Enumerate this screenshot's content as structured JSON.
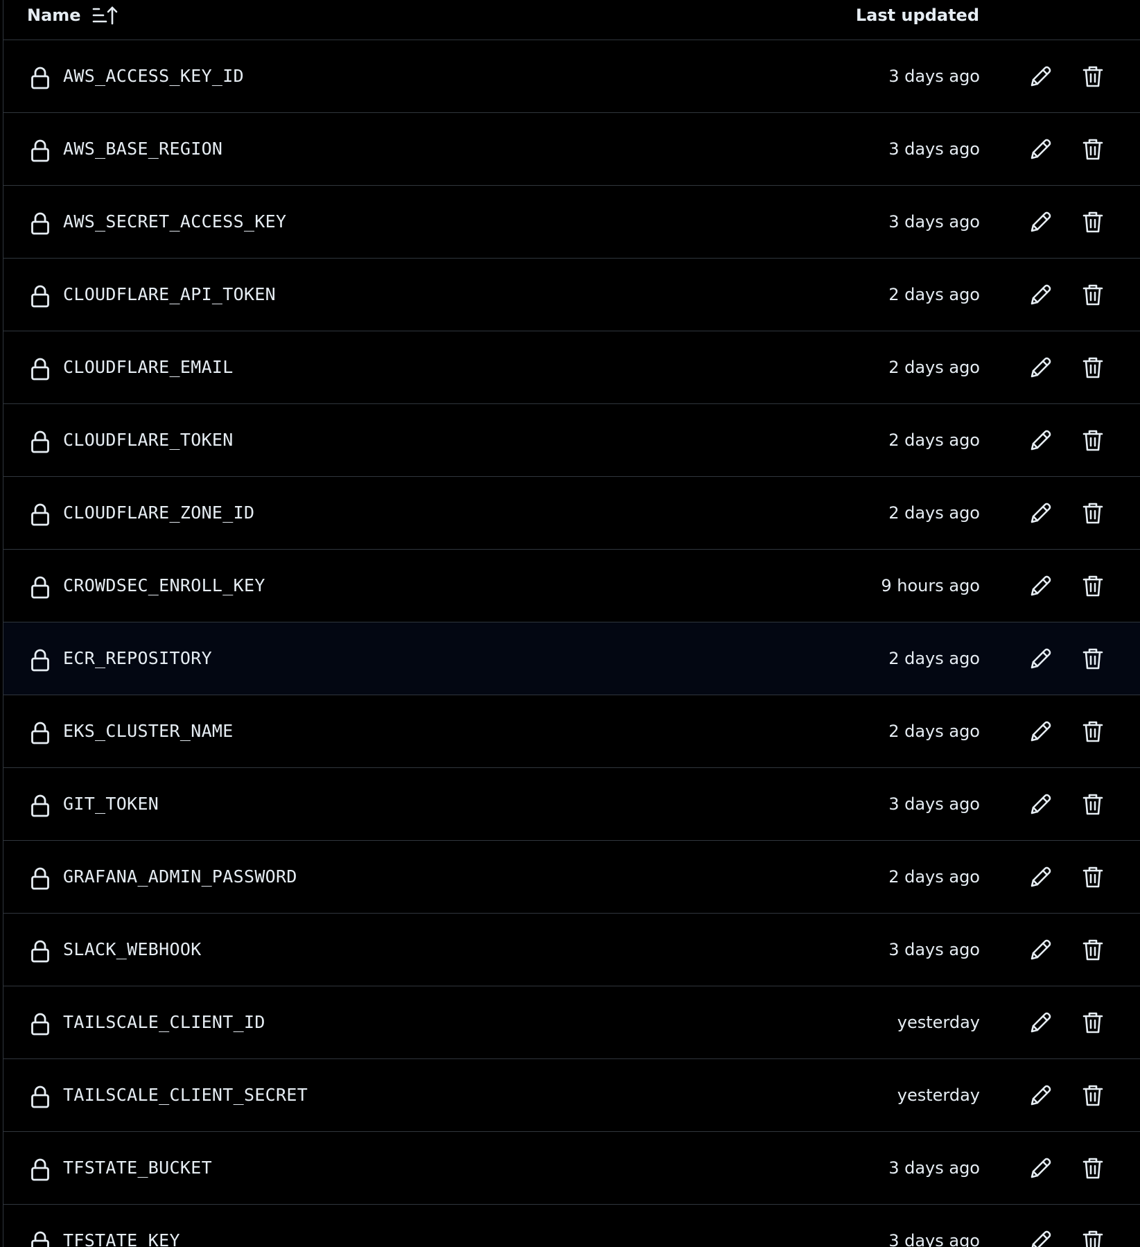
{
  "header": {
    "name_label": "Name",
    "last_updated_label": "Last updated",
    "sort_icon": "sort-ascending-icon"
  },
  "icons": {
    "row_icon": "lock-icon",
    "edit": "pencil-icon",
    "delete": "trash-icon"
  },
  "colors": {
    "background": "#000000",
    "highlight_row": "#030712",
    "border": "#30363d",
    "text": "#e6edf3"
  },
  "secrets": [
    {
      "name": "AWS_ACCESS_KEY_ID",
      "updated": "3 days ago"
    },
    {
      "name": "AWS_BASE_REGION",
      "updated": "3 days ago"
    },
    {
      "name": "AWS_SECRET_ACCESS_KEY",
      "updated": "3 days ago"
    },
    {
      "name": "CLOUDFLARE_API_TOKEN",
      "updated": "2 days ago"
    },
    {
      "name": "CLOUDFLARE_EMAIL",
      "updated": "2 days ago"
    },
    {
      "name": "CLOUDFLARE_TOKEN",
      "updated": "2 days ago"
    },
    {
      "name": "CLOUDFLARE_ZONE_ID",
      "updated": "2 days ago"
    },
    {
      "name": "CROWDSEC_ENROLL_KEY",
      "updated": "9 hours ago"
    },
    {
      "name": "ECR_REPOSITORY",
      "updated": "2 days ago",
      "highlighted": true
    },
    {
      "name": "EKS_CLUSTER_NAME",
      "updated": "2 days ago"
    },
    {
      "name": "GIT_TOKEN",
      "updated": "3 days ago"
    },
    {
      "name": "GRAFANA_ADMIN_PASSWORD",
      "updated": "2 days ago"
    },
    {
      "name": "SLACK_WEBHOOK",
      "updated": "3 days ago"
    },
    {
      "name": "TAILSCALE_CLIENT_ID",
      "updated": "yesterday"
    },
    {
      "name": "TAILSCALE_CLIENT_SECRET",
      "updated": "yesterday"
    },
    {
      "name": "TFSTATE_BUCKET",
      "updated": "3 days ago"
    },
    {
      "name": "TFSTATE_KEY",
      "updated": "3 days ago"
    }
  ]
}
